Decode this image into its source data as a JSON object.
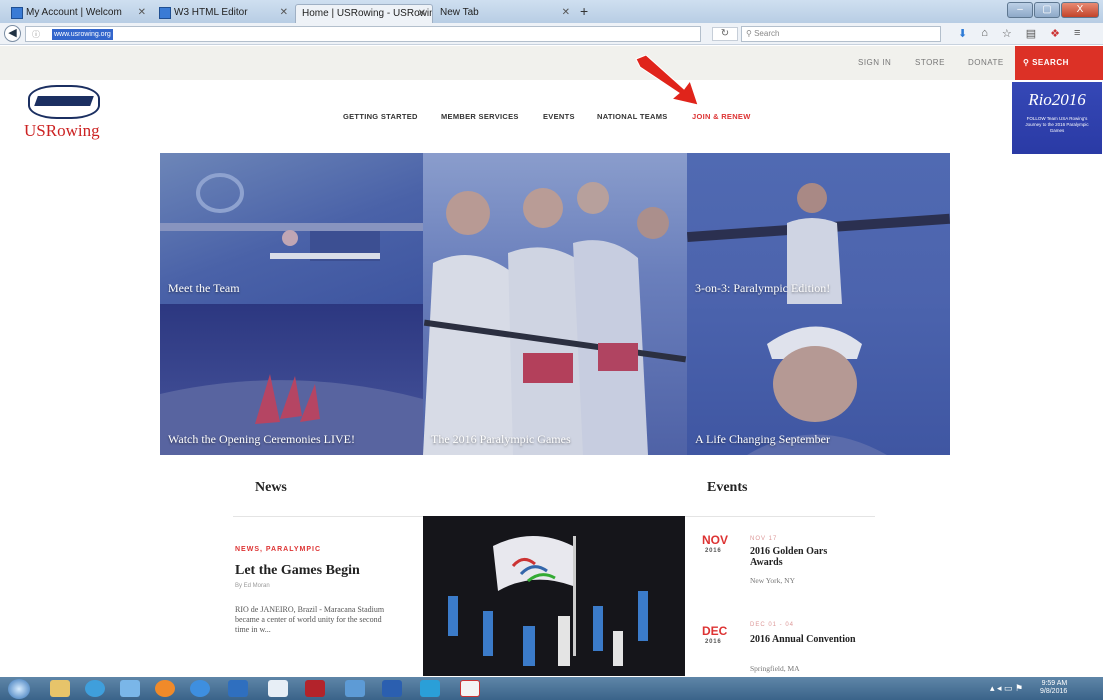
{
  "browser": {
    "tabs": [
      {
        "label": "My Account | Welcom"
      },
      {
        "label": "W3 HTML Editor"
      },
      {
        "label": "Home | USRowing - USRowing"
      },
      {
        "label": "New Tab"
      }
    ],
    "new_tab_symbol": "+",
    "url_text": "www.usrowing.org",
    "search_placeholder": "Search",
    "window_buttons": [
      "–",
      "▢",
      "X"
    ]
  },
  "site": {
    "utility_links": [
      "SIGN IN",
      "STORE",
      "DONATE"
    ],
    "search_label": "SEARCH",
    "logo_text": "USRowing",
    "nav": [
      "GETTING STARTED",
      "MEMBER SERVICES",
      "EVENTS",
      "NATIONAL TEAMS",
      "JOIN & RENEW"
    ],
    "rio": {
      "title": "Rio2016",
      "subtitle": "FOLLOW Team USA Rowing's Journey to the 2016 Paralympic Games"
    }
  },
  "tiles": [
    {
      "caption": "Meet the Team"
    },
    {
      "caption": "Watch the Opening Ceremonies LIVE!"
    },
    {
      "caption": "The 2016 Paralympic Games"
    },
    {
      "caption": "3-on-3: Paralympic Edition!"
    },
    {
      "caption": "A Life Changing September"
    }
  ],
  "news": {
    "heading": "News",
    "category": "NEWS, PARALYMPIC",
    "headline": "Let the Games Begin",
    "byline": "By Ed Moran",
    "body": "RIO de JANEIRO, Brazil - Maracana Stadium became a center of world unity for the second time in w..."
  },
  "events": {
    "heading": "Events",
    "items": [
      {
        "month": "NOV",
        "year": "2016",
        "date": "NOV 17",
        "name": "2016 Golden Oars Awards",
        "location": "New York, NY"
      },
      {
        "month": "DEC",
        "year": "2016",
        "date": "DEC 01 - 04",
        "name": "2016 Annual Convention",
        "location": "Springfield, MA"
      }
    ]
  },
  "taskbar": {
    "time": "9:59 AM",
    "date": "9/8/2016"
  },
  "colors": {
    "accent_red": "#dc3126",
    "overlay_blue": "#4a5fb0",
    "rio_blue": "#2f3faa"
  }
}
